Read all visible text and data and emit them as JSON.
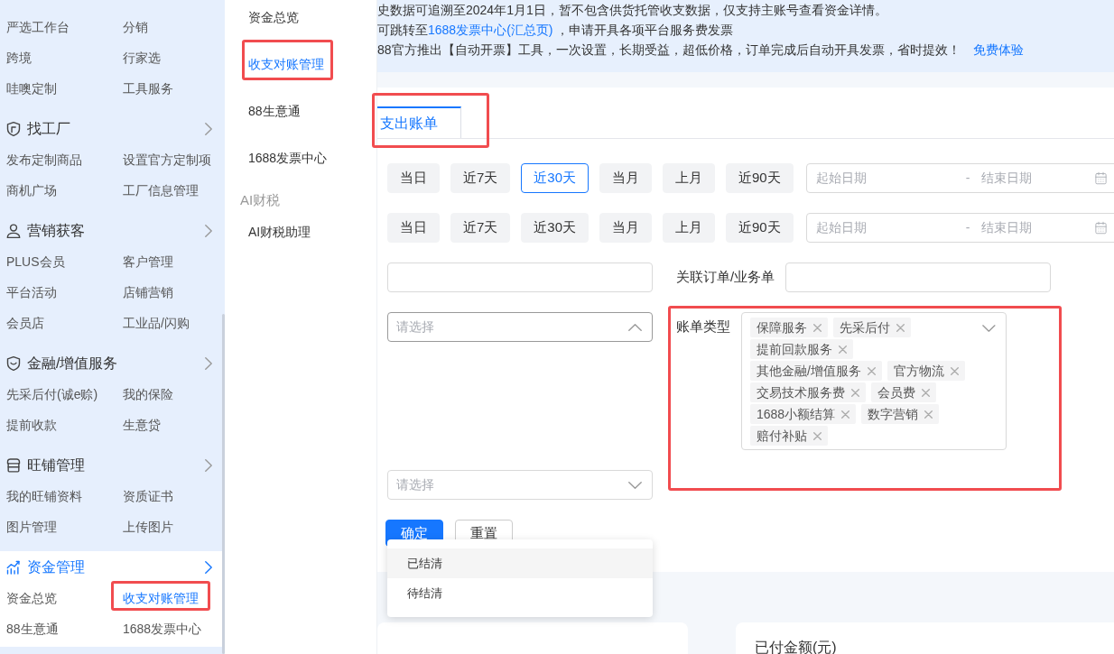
{
  "sidebar": {
    "sections": [
      {
        "items": [
          {
            "label": "严选工作台",
            "selected": false,
            "annotated": false
          },
          {
            "label": "分销",
            "selected": false,
            "annotated": false
          },
          {
            "label": "跨境",
            "selected": false,
            "annotated": false
          },
          {
            "label": "行家选",
            "selected": false,
            "annotated": false
          },
          {
            "label": "哇噢定制",
            "selected": false,
            "annotated": false
          },
          {
            "label": "工具服务",
            "selected": false,
            "annotated": false
          }
        ]
      },
      {
        "title": "找工厂",
        "selected": false,
        "items": [
          {
            "label": "发布定制商品",
            "selected": false,
            "annotated": false
          },
          {
            "label": "设置官方定制项",
            "selected": false,
            "annotated": false
          },
          {
            "label": "商机广场",
            "selected": false,
            "annotated": false
          },
          {
            "label": "工厂信息管理",
            "selected": false,
            "annotated": false
          }
        ]
      },
      {
        "title": "营销获客",
        "selected": false,
        "items": [
          {
            "label": "PLUS会员",
            "selected": false,
            "annotated": false
          },
          {
            "label": "客户管理",
            "selected": false,
            "annotated": false
          },
          {
            "label": "平台活动",
            "selected": false,
            "annotated": false
          },
          {
            "label": "店铺营销",
            "selected": false,
            "annotated": false
          },
          {
            "label": "会员店",
            "selected": false,
            "annotated": false
          },
          {
            "label": "工业品/闪购",
            "selected": false,
            "annotated": false
          }
        ]
      },
      {
        "title": "金融/增值服务",
        "selected": false,
        "items": [
          {
            "label": "先采后付(诚e赊)",
            "selected": false,
            "annotated": false
          },
          {
            "label": "我的保险",
            "selected": false,
            "annotated": false
          },
          {
            "label": "提前收款",
            "selected": false,
            "annotated": false
          },
          {
            "label": "生意贷",
            "selected": false,
            "annotated": false
          }
        ]
      },
      {
        "title": "旺铺管理",
        "selected": false,
        "items": [
          {
            "label": "我的旺铺资料",
            "selected": false,
            "annotated": false
          },
          {
            "label": "资质证书",
            "selected": false,
            "annotated": false
          },
          {
            "label": "图片管理",
            "selected": false,
            "annotated": false
          },
          {
            "label": "上传图片",
            "selected": false,
            "annotated": false
          }
        ]
      },
      {
        "title": "资金管理",
        "selected": true,
        "items": [
          {
            "label": "资金总览",
            "selected": false,
            "annotated": false
          },
          {
            "label": "收支对账管理",
            "selected": true,
            "annotated": true
          },
          {
            "label": "88生意通",
            "selected": false,
            "annotated": false
          },
          {
            "label": "1688发票中心",
            "selected": false,
            "annotated": false
          }
        ]
      }
    ]
  },
  "submenu": [
    {
      "kind": "link",
      "label": "资金总览",
      "selected": false,
      "annotated": false
    },
    {
      "kind": "link",
      "label": "收支对账管理",
      "selected": true,
      "annotated": true
    },
    {
      "kind": "link",
      "label": "88生意通",
      "selected": false,
      "annotated": false
    },
    {
      "kind": "link",
      "label": "1688发票中心",
      "selected": false,
      "annotated": false
    },
    {
      "kind": "group",
      "label": "AI财税"
    },
    {
      "kind": "link",
      "label": "AI财税助理",
      "selected": false,
      "annotated": false
    }
  ],
  "notice": {
    "lines": [
      [
        {
          "kind": "text",
          "text": "史数据可追溯至2024年1月1日，暂不包含供货托管收支数据，仅支持主账号查看资金详情。"
        }
      ],
      [
        {
          "kind": "text",
          "text": "可跳转至"
        },
        {
          "kind": "link",
          "text": "1688发票中心(汇总页)"
        },
        {
          "kind": "text",
          "text": " ，申请开具各项平台服务费发票"
        }
      ],
      [
        {
          "kind": "text",
          "text": "88官方推出【自动开票】工具，一次设置，长期受益，超低价格，订单完成后自动开具发票，省时提效！"
        },
        {
          "kind": "link",
          "text": "免费体验"
        }
      ]
    ]
  },
  "tabs": [
    {
      "label": "支出账单",
      "selected": true,
      "annotated": true
    }
  ],
  "filters": {
    "date_rows": [
      {
        "presets": [
          {
            "label": "当日",
            "selected": false
          },
          {
            "label": "近7天",
            "selected": false
          },
          {
            "label": "近30天",
            "selected": true
          },
          {
            "label": "当月",
            "selected": false
          },
          {
            "label": "上月",
            "selected": false
          },
          {
            "label": "近90天",
            "selected": false
          }
        ],
        "range": {
          "start_placeholder": "起始日期",
          "separator": "-",
          "end_placeholder": "结束日期"
        }
      },
      {
        "presets": [
          {
            "label": "当日",
            "selected": false
          },
          {
            "label": "近7天",
            "selected": false
          },
          {
            "label": "近30天",
            "selected": false
          },
          {
            "label": "当月",
            "selected": false
          },
          {
            "label": "上月",
            "selected": false
          },
          {
            "label": "近90天",
            "selected": false
          }
        ],
        "range": {
          "start_placeholder": "起始日期",
          "separator": "-",
          "end_placeholder": "结束日期"
        }
      }
    ],
    "text_inputs": [
      {
        "kind": "plain"
      },
      {
        "kind": "labeled",
        "label": "关联订单/业务单"
      }
    ],
    "status_select": {
      "placeholder": "请选择",
      "expanded": true,
      "options": [
        {
          "label": "已结清",
          "active": true
        },
        {
          "label": "待结清",
          "active": false
        }
      ]
    },
    "bill_type": {
      "label": "账单类型",
      "expanded": false,
      "annotated": true,
      "tags": [
        "保障服务",
        "先采后付",
        "提前回款服务",
        "其他金融/增值服务",
        "官方物流",
        "交易技术服务费",
        "会员费",
        "1688小额结算",
        "数字营销",
        "赔付补贴"
      ]
    },
    "other_select": {
      "placeholder": "请选择",
      "expanded": false
    }
  },
  "actions": [
    {
      "kind": "primary",
      "label": "确定"
    },
    {
      "kind": "secondary",
      "label": "重置"
    }
  ],
  "summary_cards": [
    {
      "kind": "blank"
    },
    {
      "kind": "stat",
      "title": "已付金额(元)"
    }
  ]
}
